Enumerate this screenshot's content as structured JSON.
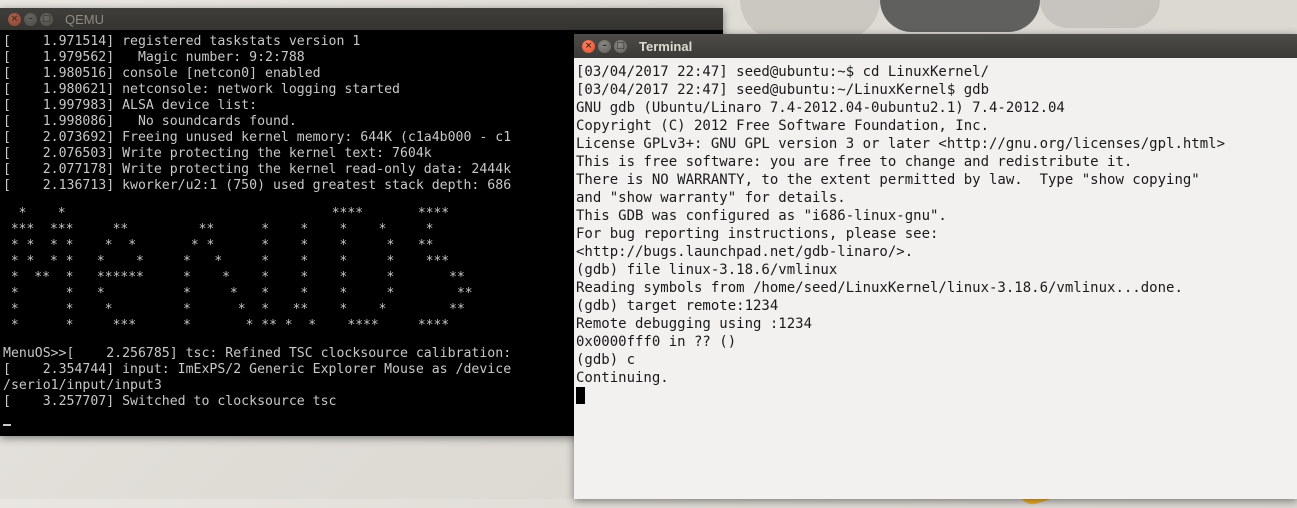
{
  "qemu": {
    "title": "QEMU",
    "boot_lines": [
      "[    1.971514] registered taskstats version 1",
      "[    1.979562]   Magic number: 9:2:788",
      "[    1.980516] console [netcon0] enabled",
      "[    1.980621] netconsole: network logging started",
      "[    1.997983] ALSA device list:",
      "[    1.998086]   No soundcards found.",
      "[    2.073692] Freeing unused kernel memory: 644K (c1a4b000 - c1",
      "[    2.076503] Write protecting the kernel text: 7604k",
      "[    2.077178] Write protecting the kernel read-only data: 2444k",
      "[    2.136713] kworker/u2:1 (750) used greatest stack depth: 686"
    ],
    "menuos_art": [
      "  *    *                                  ****       ****",
      " ***  ***     **         **      *    *    *    *     *",
      " * *  * *    *  *       * *      *    *    *     *   **",
      " * *  * *   *    *     *   *     *    *    *     *    ***",
      " *  **  *   ******     *    *    *    *    *     *       **",
      " *      *   *          *     *   *    *    *     *        **",
      " *      *    *         *      *  *   **    *    *        **",
      " *      *     ***      *       * ** *  *    ****     ****"
    ],
    "after_lines": [
      "MenuOS>>[    2.256785] tsc: Refined TSC clocksource calibration:",
      "[    2.354744] input: ImExPS/2 Generic Explorer Mouse as /device",
      "/serio1/input/input3",
      "[    3.257707] Switched to clocksource tsc"
    ]
  },
  "terminal": {
    "title": "Terminal",
    "lines": [
      "[03/04/2017 22:47] seed@ubuntu:~$ cd LinuxKernel/",
      "[03/04/2017 22:47] seed@ubuntu:~/LinuxKernel$ gdb",
      "GNU gdb (Ubuntu/Linaro 7.4-2012.04-0ubuntu2.1) 7.4-2012.04",
      "Copyright (C) 2012 Free Software Foundation, Inc.",
      "License GPLv3+: GNU GPL version 3 or later <http://gnu.org/licenses/gpl.html>",
      "This is free software: you are free to change and redistribute it.",
      "There is NO WARRANTY, to the extent permitted by law.  Type \"show copying\"",
      "and \"show warranty\" for details.",
      "This GDB was configured as \"i686-linux-gnu\".",
      "For bug reporting instructions, please see:",
      "<http://bugs.launchpad.net/gdb-linaro/>.",
      "(gdb) file linux-3.18.6/vmlinux",
      "Reading symbols from /home/seed/LinuxKernel/linux-3.18.6/vmlinux...done.",
      "(gdb) target remote:1234",
      "Remote debugging using :1234",
      "0x0000fff0 in ?? ()",
      "(gdb) c",
      "Continuing."
    ]
  },
  "window_buttons": {
    "close": "×",
    "minimize": "–",
    "maximize": "□"
  }
}
